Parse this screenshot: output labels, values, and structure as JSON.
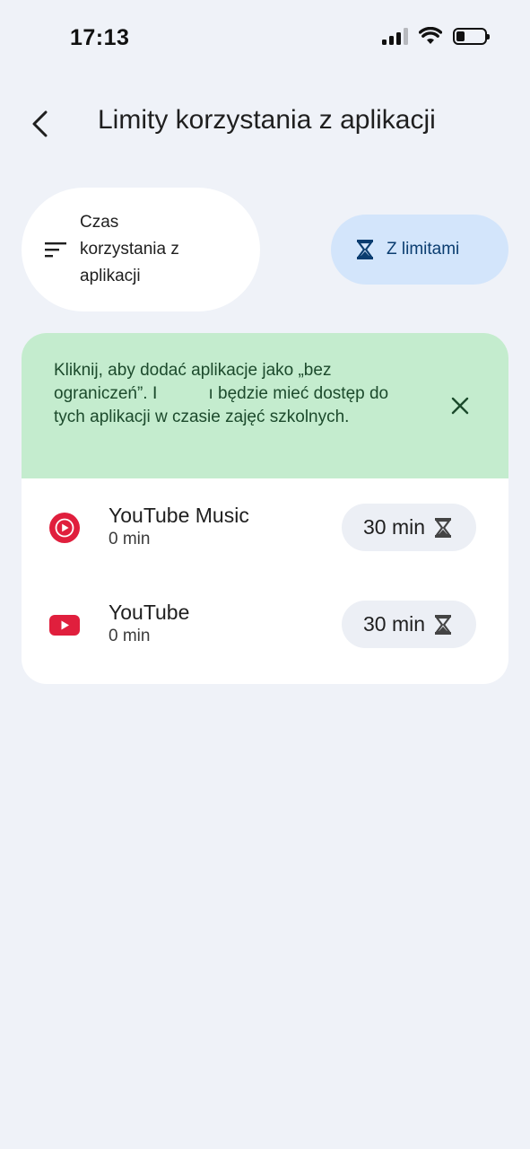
{
  "status_bar": {
    "time": "17:13"
  },
  "header": {
    "title": "Limity korzystania z aplikacji"
  },
  "filters": {
    "sort_label_lines": [
      "Czas",
      "korzystania z",
      "aplikacji"
    ],
    "limit_label": "Z limitami"
  },
  "banner": {
    "text": "Kliknij, aby dodać aplikacje jako „bez ograniczeń”. Ⅰ   ı będzie mieć dostęp do tych aplikacji w czasie zajęć szkolnych."
  },
  "apps": [
    {
      "name": "YouTube Music",
      "usage": "0 min",
      "limit": "30 min",
      "icon": "youtube-music-icon"
    },
    {
      "name": "YouTube",
      "usage": "0 min",
      "limit": "30 min",
      "icon": "youtube-icon"
    }
  ],
  "colors": {
    "background": "#eff2f8",
    "banner": "#c4ecce",
    "limit_chip": "#d3e5fb",
    "youtube_red": "#e01f3d"
  }
}
